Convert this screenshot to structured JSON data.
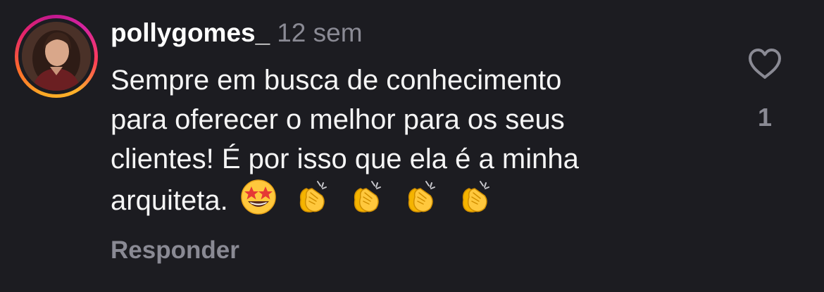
{
  "comment": {
    "username": "pollygomes_",
    "time": "12 sem",
    "text_lines": [
      "Sempre em busca de conhecimento",
      "para oferecer o melhor para os seus",
      "clientes! É por isso que ela é a minha",
      "arquiteta."
    ],
    "emojis": [
      "star-struck",
      "clapping-hands",
      "clapping-hands",
      "clapping-hands",
      "clapping-hands"
    ],
    "reply_label": "Responder",
    "like_count": "1",
    "like_icon": "heart-outline-icon"
  },
  "colors": {
    "background": "#1c1c21",
    "text": "#f5f5f5",
    "muted": "#8a8a94",
    "emoji_yellow": "#ffc83d"
  }
}
